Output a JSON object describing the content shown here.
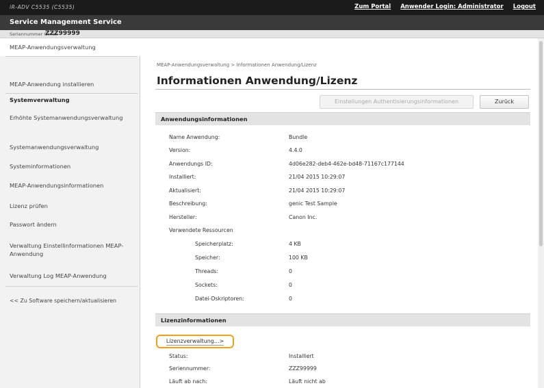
{
  "topbar": {
    "device_name": "iR-ADV C5535 (C5535)",
    "links": [
      "Zum Portal",
      "Anwender Login: Administrator",
      "Logout"
    ]
  },
  "app": {
    "title": "Service Management Service"
  },
  "serial": {
    "label": "Seriennummer Gerät:",
    "value": "ZZZ99999"
  },
  "sidebar": {
    "items": [
      {
        "label": "MEAP-Anwendungsverwaltung"
      },
      {
        "label": "MEAP-Anwendung installieren"
      }
    ],
    "system_heading": "Systemverwaltung",
    "system_items": [
      {
        "label": "Erhöhte Systemanwendungsverwaltung"
      },
      {
        "label": "Systemanwendungsverwaltung"
      },
      {
        "label": "Systeminformationen"
      },
      {
        "label": "MEAP-Anwendungsinformationen"
      },
      {
        "label": "Lizenz prüfen"
      },
      {
        "label": "Passwort ändern"
      },
      {
        "label": "Verwaltung Einstellinformationen MEAP-Anwendung"
      },
      {
        "label": "Verwaltung Log MEAP-Anwendung"
      }
    ],
    "bottom_link": "<< Zu Software speichern/aktualisieren"
  },
  "main": {
    "breadcrumb": "MEAP-Anwendungsverwaltung > Informationen Anwendung/Lizenz",
    "title": "Informationen Anwendung/Lizenz",
    "auth_button": "Einstellungen Authentisierungsinformationen",
    "back_button": "Zurück",
    "app_info": {
      "heading": "Anwendungsinformationen",
      "rows": [
        {
          "label": "Name Anwendung:",
          "value": "Bundle"
        },
        {
          "label": "Version:",
          "value": "4.4.0"
        },
        {
          "label": "Anwendungs ID:",
          "value": "4d06e282-deb4-462e-bd48-71167c177144"
        },
        {
          "label": "Installiert:",
          "value": "21/04 2015 10:29:07"
        },
        {
          "label": "Aktualisiert:",
          "value": "21/04 2015 10:29:07"
        },
        {
          "label": "Beschreibung:",
          "value": "genic Test Sample"
        },
        {
          "label": "Hersteller:",
          "value": "Canon Inc."
        }
      ],
      "resources_label": "Verwendete Ressourcen",
      "resources": [
        {
          "label": "Speicherplatz:",
          "value": "4 KB"
        },
        {
          "label": "Speicher:",
          "value": "100 KB"
        },
        {
          "label": "Threads:",
          "value": "0"
        },
        {
          "label": "Sockets:",
          "value": "0"
        },
        {
          "label": "Datei-Dskriptoren:",
          "value": "0"
        }
      ]
    },
    "license_info": {
      "heading": "Lizenzinformationen",
      "manage_button": "Lizenzverwaltung...>",
      "rows": [
        {
          "label": "Status:",
          "value": "Installiert"
        },
        {
          "label": "Seriennummer:",
          "value": "ZZZ99999"
        },
        {
          "label": "Läuft ab nach:",
          "value": "Läuft nicht ab"
        }
      ]
    }
  }
}
